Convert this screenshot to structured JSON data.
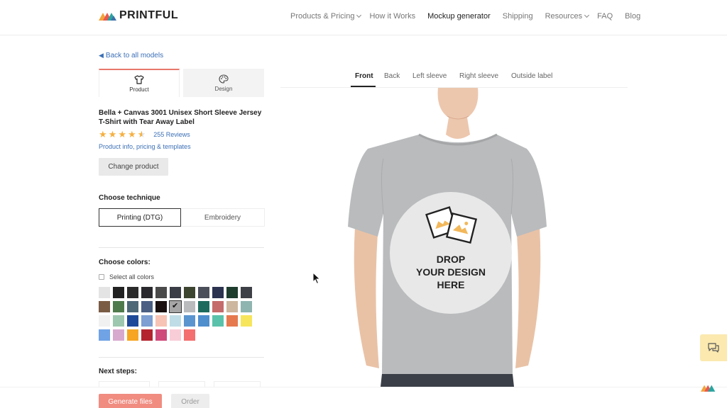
{
  "header": {
    "logo_text": "PRINTFUL",
    "nav": [
      {
        "label": "Products & Pricing",
        "dropdown": true
      },
      {
        "label": "How it Works",
        "dropdown": false
      },
      {
        "label": "Mockup generator",
        "dropdown": false,
        "active": true
      },
      {
        "label": "Shipping",
        "dropdown": false
      },
      {
        "label": "Resources",
        "dropdown": true
      },
      {
        "label": "FAQ",
        "dropdown": false
      },
      {
        "label": "Blog",
        "dropdown": false
      }
    ]
  },
  "sidebar": {
    "back_link": "Back to all models",
    "tabs": {
      "product": "Product",
      "design": "Design"
    },
    "product_title": "Bella + Canvas 3001 Unisex Short Sleeve Jersey T-Shirt with Tear Away Label",
    "rating": 4.5,
    "reviews": "255 Reviews",
    "info_link": "Product info, pricing & templates",
    "change_button": "Change product",
    "technique_label": "Choose technique",
    "techniques": {
      "printing": "Printing (DTG)",
      "embroidery": "Embroidery"
    },
    "colors_label": "Choose colors:",
    "select_all": "Select all colors",
    "swatch_rows": [
      [
        "#e4e4e4",
        "#222222",
        "#2b2b2b",
        "#2a2a2e",
        "#4a4a4a",
        "#3a3d45",
        "#3d4530",
        "#4b4f5a",
        "#2c3350",
        "#1f3d2e",
        "#3d4046"
      ],
      [
        "#7a5c45",
        "#4f7b4c",
        "#4e6878",
        "#4a5f82",
        "#1a1010",
        "#a6a6a6",
        "#b9bbbd",
        "#1d6b5d",
        "#c66b6b",
        "#cdb79e",
        "#8fb5b0"
      ],
      [
        "#f1f1f1",
        "#9ec7b0",
        "#1f4a9a",
        "#7d9fd1",
        "#f7c3b4",
        "#bfdde6",
        "#5b95cf",
        "#4f8fce",
        "#5ac2aa",
        "#e67a4e",
        "#f7e55c"
      ],
      [
        "#6fa3e6",
        "#d8a9cf",
        "#f6a623",
        "#b3242f",
        "#cf4a7b",
        "#f9cdd8",
        "#f46f6f"
      ]
    ],
    "selected_swatch": "1.5",
    "next_steps_label": "Next steps:",
    "generate_button": "Generate files",
    "order_button": "Order"
  },
  "views": {
    "tabs": [
      "Front",
      "Back",
      "Left sleeve",
      "Right sleeve",
      "Outside label"
    ],
    "active": "Front"
  },
  "mockup": {
    "drop_line1": "DROP",
    "drop_line2": "YOUR DESIGN",
    "drop_line3": "HERE",
    "shirt_color": "#b9bbbd"
  },
  "colors": {
    "accent": "#e8776b",
    "link": "#3b6fb6",
    "generate": "#f08c80"
  }
}
